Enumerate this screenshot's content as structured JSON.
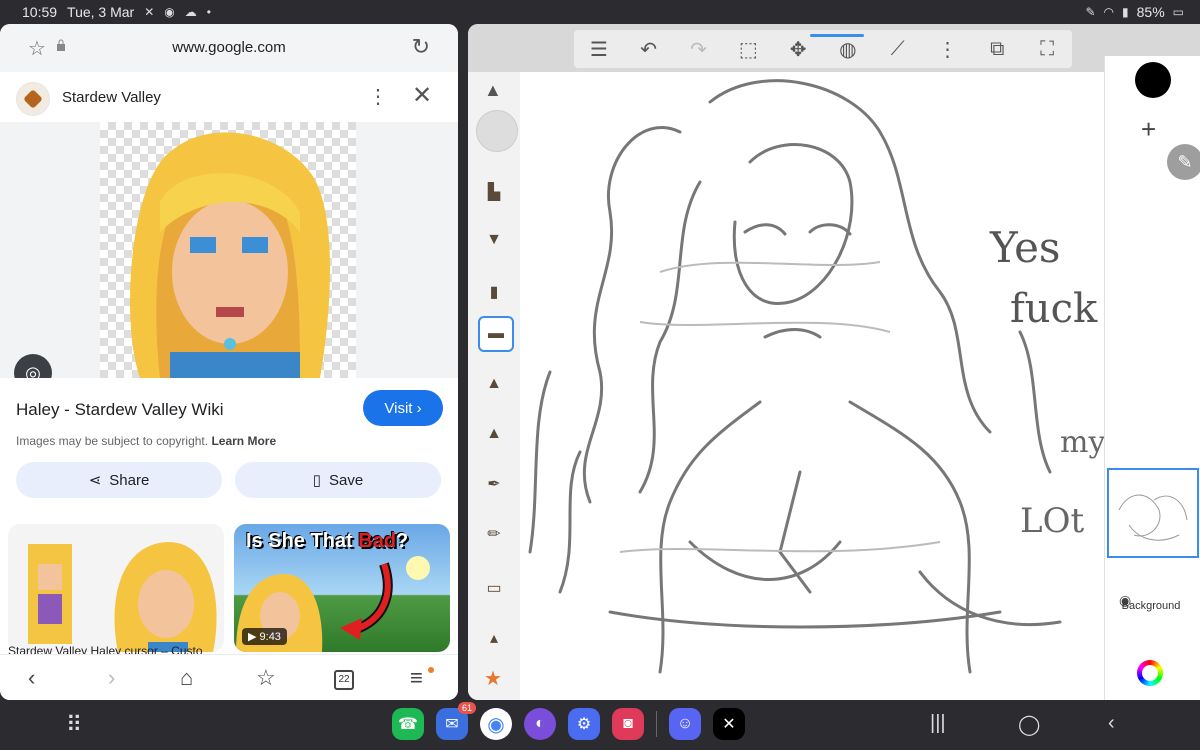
{
  "status": {
    "time": "10:59",
    "date": "Tue, 3 Mar",
    "battery": "85%",
    "icons_left": [
      "mute-icon",
      "messenger-icon",
      "cloud-icon",
      "dot-icon"
    ],
    "icons_right": [
      "pen-icon",
      "wifi-icon",
      "signal-icon",
      "battery-icon"
    ]
  },
  "browser": {
    "url": "www.google.com",
    "site_name": "Stardew Valley",
    "result_title": "Haley - Stardew Valley Wiki",
    "visit_label": "Visit",
    "copyright_text": "Images may be subject to copyright.",
    "learn_more": "Learn More",
    "share_label": "Share",
    "save_label": "Save",
    "cards": [
      {
        "caption": "Stardew Valley Haley cursor – Custo"
      },
      {
        "video_title_1": "Is She That ",
        "video_title_red": "Bad",
        "video_title_2": "?",
        "duration": "9:43"
      }
    ],
    "tab_count": "22"
  },
  "drawing": {
    "layer_label": "Background",
    "toolbar_icons": [
      "list-icon",
      "undo-icon",
      "redo-icon",
      "select-icon",
      "transform-icon",
      "fill-icon",
      "ruler-icon",
      "symmetry-icon",
      "layers-icon",
      "fullscreen-icon"
    ],
    "brush_color": "#000000",
    "canvas_text": [
      "Yes",
      "fuck",
      "my",
      "LOt"
    ]
  },
  "taskbar": {
    "messages_badge": "61",
    "apps": [
      "phone",
      "messages",
      "chrome",
      "browser",
      "settings",
      "camera",
      "discord",
      "x"
    ]
  }
}
